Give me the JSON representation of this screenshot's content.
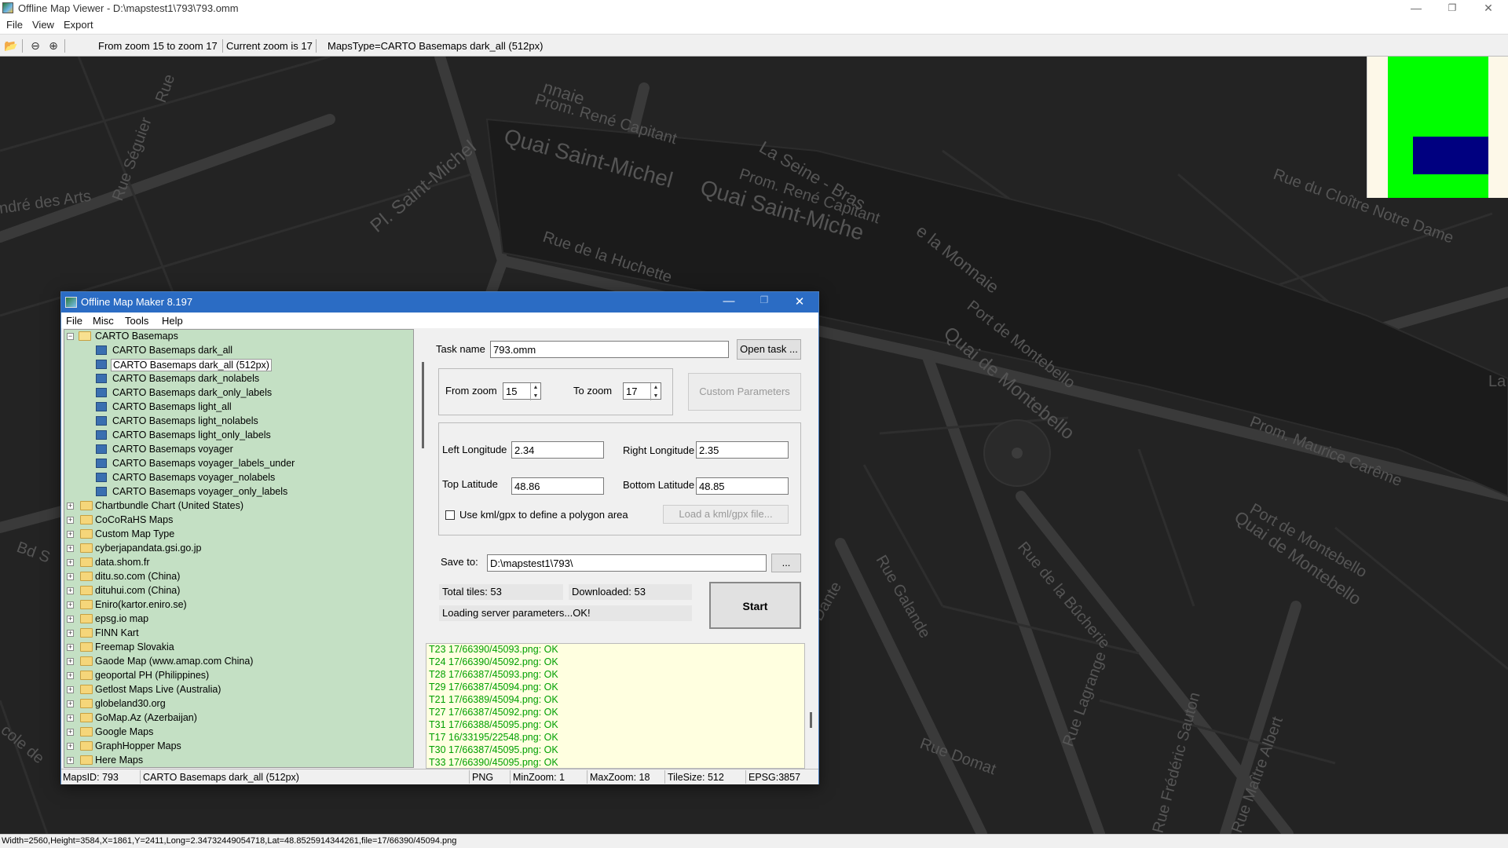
{
  "window": {
    "title": "Offline Map Viewer - D:\\mapstest1\\793\\793.omm",
    "minimize": "—",
    "restore": "❐",
    "close": "✕"
  },
  "menu": [
    "File",
    "View",
    "Export"
  ],
  "toolbar": {
    "zoom_range": "From zoom 15 to zoom 17",
    "current_zoom": "Current zoom is 17",
    "maps_type": "MapsType=CARTO Basemaps dark_all (512px)"
  },
  "map_labels": [
    "Quai Saint-Michel",
    "Quai Saint-Miche",
    "Pl. Saint-Michel",
    "Prom. René Capitant",
    "Prom. René Capitant",
    "La Seine - Bras",
    "e la Monnaie",
    "Rue de la Huchette",
    "Rue du Cloître Notre Dame",
    "Port de Montebello",
    "Quai de Montebello",
    "Prom. Maurice Carême",
    "Quai de Montebello",
    "Port de Montebello",
    "Rue de la Bûcherie",
    "Rue Galande",
    "Rue Lagrange",
    "Rue Domat",
    "Rue Frédéric Sauton",
    "Rue Maître Albert",
    "ndré des Arts",
    "Rue Séguier",
    "Rue",
    "nnaie",
    "La",
    "Dante",
    "Bd S",
    "cole de"
  ],
  "status": "Width=2560,Height=3584,X=1861,Y=2411,Long=2.34732449054718,Lat=48.8525914344261,file=17/66390/45094.png",
  "dialog": {
    "title": "Offline Map Maker 8.197",
    "menu": [
      "File",
      "Misc",
      "Tools",
      "Help"
    ],
    "tree": {
      "expanded_group": "CARTO Basemaps",
      "children": [
        "CARTO Basemaps dark_all",
        "CARTO Basemaps dark_all (512px)",
        "CARTO Basemaps dark_nolabels",
        "CARTO Basemaps dark_only_labels",
        "CARTO Basemaps light_all",
        "CARTO Basemaps light_nolabels",
        "CARTO Basemaps light_only_labels",
        "CARTO Basemaps voyager",
        "CARTO Basemaps voyager_labels_under",
        "CARTO Basemaps voyager_nolabels",
        "CARTO Basemaps voyager_only_labels"
      ],
      "selected": "CARTO Basemaps dark_all (512px)",
      "groups": [
        "Chartbundle Chart (United States)",
        "CoCoRaHS Maps",
        "Custom Map Type",
        "cyberjapandata.gsi.go.jp",
        "data.shom.fr",
        "ditu.so.com (China)",
        "dituhui.com (China)",
        "Eniro(kartor.eniro.se)",
        "epsg.io map",
        "FINN Kart",
        "Freemap Slovakia",
        "Gaode Map (www.amap.com China)",
        "geoportal PH (Philippines)",
        "Getlost Maps Live (Australia)",
        "globeland30.org",
        "GoMap.Az (Azerbaijan)",
        "Google Maps",
        "GraphHopper Maps",
        "Here Maps"
      ]
    },
    "task_name_label": "Task name",
    "task_name": "793.omm",
    "open_task": "Open task ...",
    "from_zoom_label": "From zoom",
    "from_zoom": "15",
    "to_zoom_label": "To zoom",
    "to_zoom": "17",
    "custom_params": "Custom Parameters",
    "left_lon_label": "Left Longitude",
    "left_lon": "2.34",
    "right_lon_label": "Right Longitude",
    "right_lon": "2.35",
    "top_lat_label": "Top Latitude",
    "top_lat": "48.86",
    "bottom_lat_label": "Bottom Latitude",
    "bottom_lat": "48.85",
    "kml_label": "Use kml/gpx to define a polygon area",
    "load_kml": "Load a kml/gpx file...",
    "save_to_label": "Save to:",
    "save_to": "D:\\mapstest1\\793\\",
    "browse": "...",
    "total_tiles": "Total tiles: 53",
    "downloaded": "Downloaded: 53",
    "loading": "Loading server parameters...OK!",
    "start": "Start",
    "log": [
      "T23 17/66390/45093.png: OK",
      "T24 17/66390/45092.png: OK",
      "T28 17/66387/45093.png: OK",
      "T29 17/66387/45094.png: OK",
      "T21 17/66389/45094.png: OK",
      "T27 17/66387/45092.png: OK",
      "T31 17/66388/45095.png: OK",
      "T17 16/33195/22548.png: OK",
      "T30 17/66387/45095.png: OK",
      "T33 17/66390/45095.png: OK"
    ],
    "status": {
      "maps_id": "MapsID: 793",
      "maps_name": "CARTO Basemaps dark_all (512px)",
      "format": "PNG",
      "min_zoom": "MinZoom: 1",
      "max_zoom": "MaxZoom: 18",
      "tile_size": "TileSize: 512",
      "epsg": "EPSG:3857"
    }
  }
}
